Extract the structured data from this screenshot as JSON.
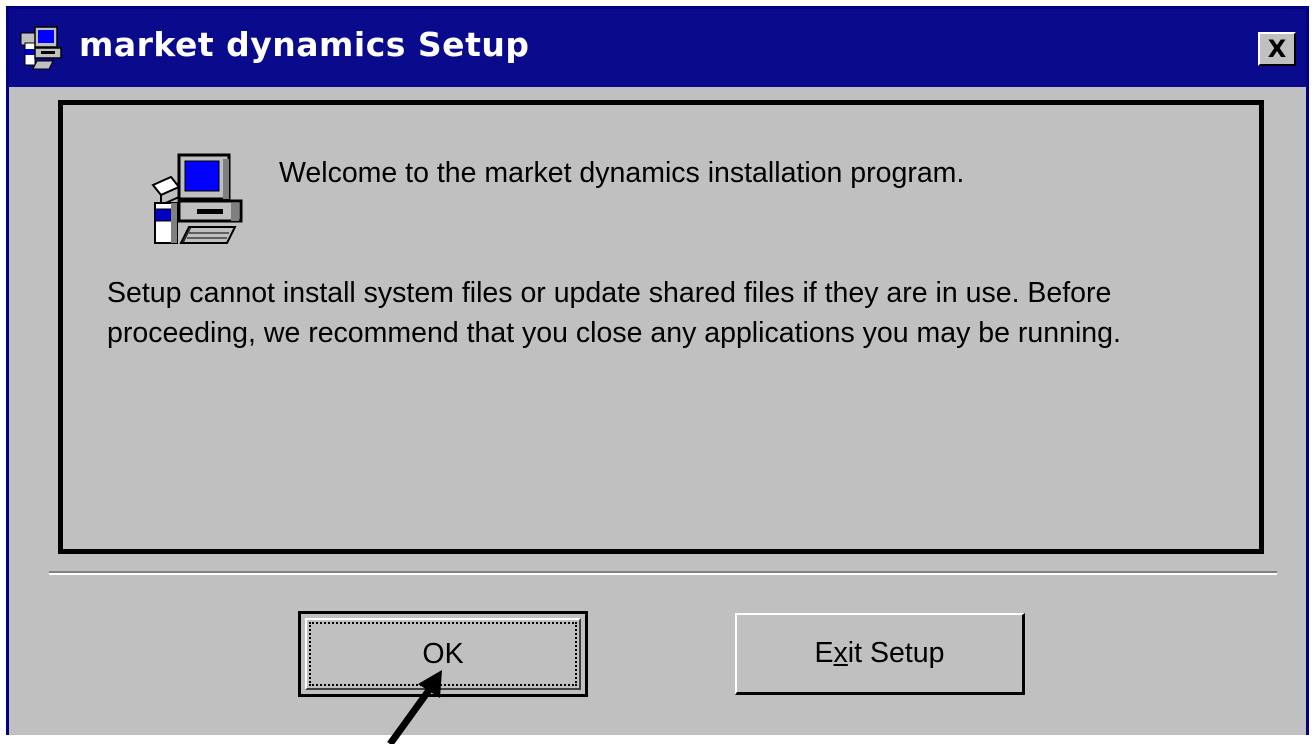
{
  "window": {
    "title": "market dynamics Setup",
    "close_glyph": "X",
    "title_icon": "setup-computer-icon"
  },
  "content": {
    "welcome": "Welcome to the market dynamics installation program.",
    "body": "Setup cannot install system files or update shared files if they are in use. Before proceeding, we recommend that you close any applications you may be running.",
    "icon": "setup-computer-icon"
  },
  "buttons": {
    "ok_label": "OK",
    "exit_label_pre": "E",
    "exit_label_accel": "x",
    "exit_label_post": "it Setup"
  },
  "colors": {
    "titlebar": "#0a0a8c",
    "face": "#c0c0c0",
    "title_text": "#ffffff"
  }
}
